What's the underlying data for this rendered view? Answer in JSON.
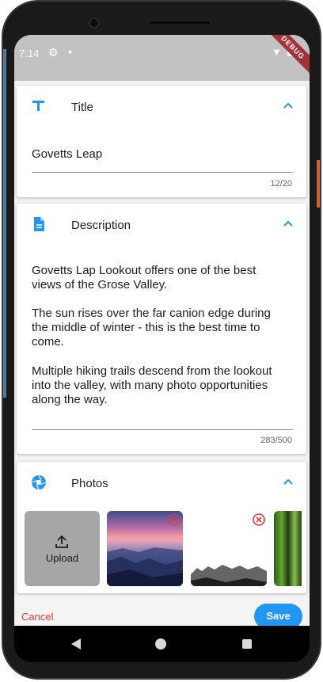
{
  "status_bar": {
    "time": "7:14",
    "debug_label": "DEBUG"
  },
  "colors": {
    "accent": "#2196F3",
    "danger": "#E53935",
    "upload_tile": "#A6A6A6"
  },
  "title_card": {
    "heading": "Title",
    "icon": "title-text-icon",
    "value": "Govetts Leap",
    "counter": "12/20"
  },
  "description_card": {
    "heading": "Description",
    "icon": "document-icon",
    "lines": [
      "Govetts Lap Lookout offers one of the best",
      "views of the Grose Valley.",
      "",
      "The sun rises over the far canion edge during",
      "the middle of winter - this is the best time to",
      "come.",
      "",
      "Multiple hiking trails descend from the lookout",
      "into the valley, with many photo opportunities",
      "along the way."
    ],
    "counter": "283/500"
  },
  "photos_card": {
    "heading": "Photos",
    "icon": "camera-aperture-icon",
    "upload_label": "Upload"
  },
  "actions": {
    "cancel_label": "Cancel",
    "save_label": "Save"
  }
}
